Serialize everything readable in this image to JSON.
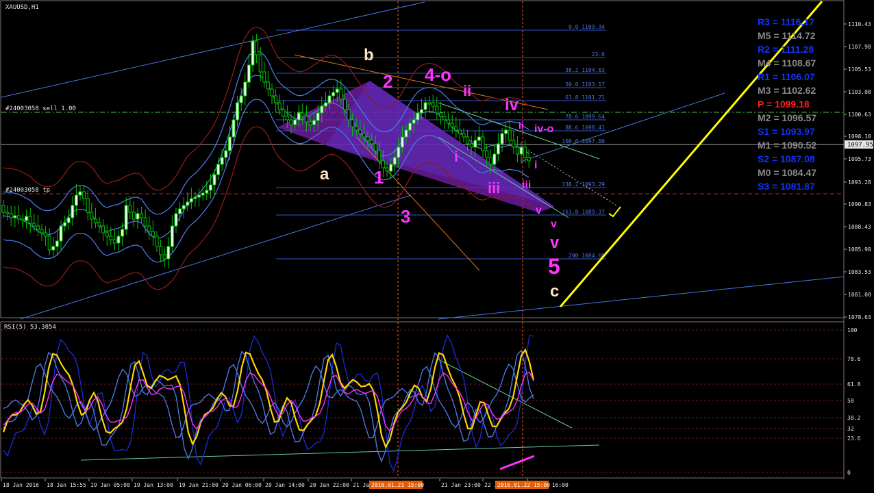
{
  "main_panel": {
    "symbol_label": "XAUUSD,H1",
    "order_line_label": "#24003058 sell 1.00",
    "tp_line_label": "#24003058 tp",
    "current_price_badge": "1097.95",
    "price_ticks": [
      "1110.43",
      "1107.98",
      "1105.53",
      "1103.08",
      "1100.63",
      "1098.18",
      "1095.73",
      "1093.28",
      "1090.83",
      "1088.43",
      "1085.98",
      "1083.53",
      "1081.08",
      "1078.63"
    ],
    "fib_levels": [
      {
        "label": "0.0 1109.34"
      },
      {
        "label": "23.6"
      },
      {
        "label": "38.2 1104.63"
      },
      {
        "label": "50.0 1103.17"
      },
      {
        "label": "61.8 1101.71"
      },
      {
        "label": "78.6 1099.64"
      },
      {
        "label": "88.6 1098.41"
      },
      {
        "label": "100.0 1097.00"
      },
      {
        "label": "138.2 1093.29"
      },
      {
        "label": "161.8 1089.37"
      },
      {
        "label": "200 1084.68"
      }
    ],
    "wave_labels": [
      {
        "text": "b",
        "color": "#ffe4c4"
      },
      {
        "text": "a",
        "color": "#ffe4c4"
      },
      {
        "text": "2",
        "color": "#ff33ff"
      },
      {
        "text": "4-o",
        "color": "#ff33ff"
      },
      {
        "text": "ii",
        "color": "#ff33ff"
      },
      {
        "text": "iv",
        "color": "#ff33ff"
      },
      {
        "text": "ii",
        "color": "#ff33ff"
      },
      {
        "text": "iv-o",
        "color": "#ff33ff"
      },
      {
        "text": "i",
        "color": "#ff33ff"
      },
      {
        "text": "i",
        "color": "#ff33ff"
      },
      {
        "text": "1",
        "color": "#ff33ff"
      },
      {
        "text": "iii",
        "color": "#ff33ff"
      },
      {
        "text": "iii",
        "color": "#ff33ff"
      },
      {
        "text": "3",
        "color": "#ff33ff"
      },
      {
        "text": "v",
        "color": "#ff33ff"
      },
      {
        "text": "v",
        "color": "#ff33ff"
      },
      {
        "text": "v",
        "color": "#ff33ff"
      },
      {
        "text": "5",
        "color": "#ff33ff"
      },
      {
        "text": "c",
        "color": "#ffe4c4"
      }
    ],
    "pivots": [
      {
        "name": "R3",
        "value": "1116.17",
        "color": "#1133ff"
      },
      {
        "name": "M5",
        "value": "1114.72",
        "color": "#888888"
      },
      {
        "name": "R2",
        "value": "1111.28",
        "color": "#1133ff"
      },
      {
        "name": "M4",
        "value": "1108.67",
        "color": "#888888"
      },
      {
        "name": "R1",
        "value": "1106.07",
        "color": "#1133ff"
      },
      {
        "name": "M3",
        "value": "1102.62",
        "color": "#888888"
      },
      {
        "name": "P",
        "value": "1099.18",
        "color": "#ff2020"
      },
      {
        "name": "M2",
        "value": "1096.57",
        "color": "#888888"
      },
      {
        "name": "S1",
        "value": "1093.97",
        "color": "#1133ff"
      },
      {
        "name": "M1",
        "value": "1090.52",
        "color": "#888888"
      },
      {
        "name": "S2",
        "value": "1087.08",
        "color": "#1133ff"
      },
      {
        "name": "M0",
        "value": "1084.47",
        "color": "#888888"
      },
      {
        "name": "S3",
        "value": "1081.87",
        "color": "#1133ff"
      }
    ]
  },
  "rsi_panel": {
    "label": "RSI(5) 53.3854",
    "ticks": [
      "100",
      "78.6",
      "61.8",
      "50",
      "38.2",
      "32",
      "23.6",
      "0"
    ]
  },
  "time_axis": {
    "labels": [
      "18 Jan 2016",
      "18 Jan 15:55",
      "19 Jan 05:00",
      "19 Jan 13:00",
      "19 Jan 21:00",
      "20 Jan 06:00",
      "20 Jan 14:00",
      "20 Jan 22:00",
      "21 Jan 2016",
      "21 Jan 23:00",
      "22 Jan",
      "22 Jan 16:00"
    ],
    "highlight_1": "2016.01.21 15:00",
    "highlight_2": "2016.01.22 15:00"
  },
  "colors": {
    "background": "#000000",
    "bull_candle": "#e6ffe6",
    "bear_candle": "#000000",
    "candle_wick": "#00c800",
    "bollinger": "#4a78e0",
    "bollinger_outer": "#8b1a1a",
    "fib": "#3355cc",
    "yellow_line": "#ffff00",
    "pattern_fill": "#7a1fb0",
    "rsi_main": "#ffd700",
    "rsi_ma": "#ff33ff",
    "rsi_bands": "#1a2ad0"
  }
}
